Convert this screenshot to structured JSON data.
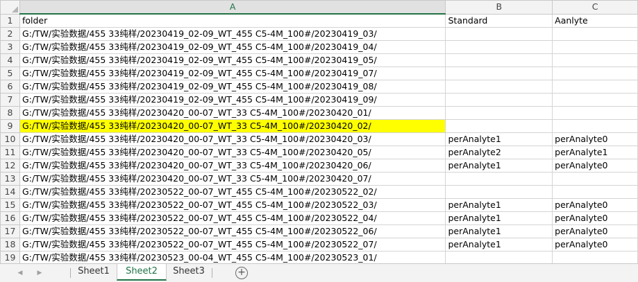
{
  "columns": [
    "A",
    "B",
    "C"
  ],
  "rows": [
    {
      "n": "1",
      "a": "folder",
      "b": "Standard",
      "c": "Aanlyte"
    },
    {
      "n": "2",
      "a": "G:/TW/实验数据/455 33纯样/20230419_02-09_WT_455 C5-4M_100#/20230419_03/",
      "b": "",
      "c": ""
    },
    {
      "n": "3",
      "a": "G:/TW/实验数据/455 33纯样/20230419_02-09_WT_455 C5-4M_100#/20230419_04/",
      "b": "",
      "c": ""
    },
    {
      "n": "4",
      "a": "G:/TW/实验数据/455 33纯样/20230419_02-09_WT_455 C5-4M_100#/20230419_05/",
      "b": "",
      "c": ""
    },
    {
      "n": "5",
      "a": "G:/TW/实验数据/455 33纯样/20230419_02-09_WT_455 C5-4M_100#/20230419_07/",
      "b": "",
      "c": ""
    },
    {
      "n": "6",
      "a": "G:/TW/实验数据/455 33纯样/20230419_02-09_WT_455 C5-4M_100#/20230419_08/",
      "b": "",
      "c": ""
    },
    {
      "n": "7",
      "a": "G:/TW/实验数据/455 33纯样/20230419_02-09_WT_455 C5-4M_100#/20230419_09/",
      "b": "",
      "c": ""
    },
    {
      "n": "8",
      "a": "G:/TW/实验数据/455 33纯样/20230420_00-07_WT_33 C5-4M_100#/20230420_01/",
      "b": "",
      "c": ""
    },
    {
      "n": "9",
      "a": "G:/TW/实验数据/455 33纯样/20230420_00-07_WT_33 C5-4M_100#/20230420_02/",
      "b": "",
      "c": "",
      "highlight": true
    },
    {
      "n": "10",
      "a": "G:/TW/实验数据/455 33纯样/20230420_00-07_WT_33 C5-4M_100#/20230420_03/",
      "b": "perAnalyte1",
      "c": "perAnalyte0"
    },
    {
      "n": "11",
      "a": "G:/TW/实验数据/455 33纯样/20230420_00-07_WT_33 C5-4M_100#/20230420_05/",
      "b": "perAnalyte2",
      "c": "perAnalyte1"
    },
    {
      "n": "12",
      "a": "G:/TW/实验数据/455 33纯样/20230420_00-07_WT_33 C5-4M_100#/20230420_06/",
      "b": "perAnalyte1",
      "c": "perAnalyte0"
    },
    {
      "n": "13",
      "a": "G:/TW/实验数据/455 33纯样/20230420_00-07_WT_33 C5-4M_100#/20230420_07/",
      "b": "",
      "c": ""
    },
    {
      "n": "14",
      "a": "G:/TW/实验数据/455 33纯样/20230522_00-07_WT_455 C5-4M_100#/20230522_02/",
      "b": "",
      "c": ""
    },
    {
      "n": "15",
      "a": "G:/TW/实验数据/455 33纯样/20230522_00-07_WT_455 C5-4M_100#/20230522_03/",
      "b": "perAnalyte1",
      "c": "perAnalyte0"
    },
    {
      "n": "16",
      "a": "G:/TW/实验数据/455 33纯样/20230522_00-07_WT_455 C5-4M_100#/20230522_04/",
      "b": "perAnalyte1",
      "c": "perAnalyte0"
    },
    {
      "n": "17",
      "a": "G:/TW/实验数据/455 33纯样/20230522_00-07_WT_455 C5-4M_100#/20230522_06/",
      "b": "perAnalyte1",
      "c": "perAnalyte0"
    },
    {
      "n": "18",
      "a": "G:/TW/实验数据/455 33纯样/20230522_00-07_WT_455 C5-4M_100#/20230522_07/",
      "b": "perAnalyte1",
      "c": "perAnalyte0"
    },
    {
      "n": "19",
      "a": "G:/TW/实验数据/455 33纯样/20230523_00-04_WT_455 C5-4M_100#/20230523_01/",
      "b": "",
      "c": ""
    }
  ],
  "sheet_tabs": [
    "Sheet1",
    "Sheet2",
    "Sheet3"
  ],
  "active_tab": "Sheet2",
  "add_sheet_label": "+",
  "colors": {
    "highlight": "#ffff00",
    "accent": "#217346"
  },
  "icons": {
    "prev": "triangle-left-icon",
    "next": "triangle-right-icon",
    "add": "plus-circle-icon"
  }
}
